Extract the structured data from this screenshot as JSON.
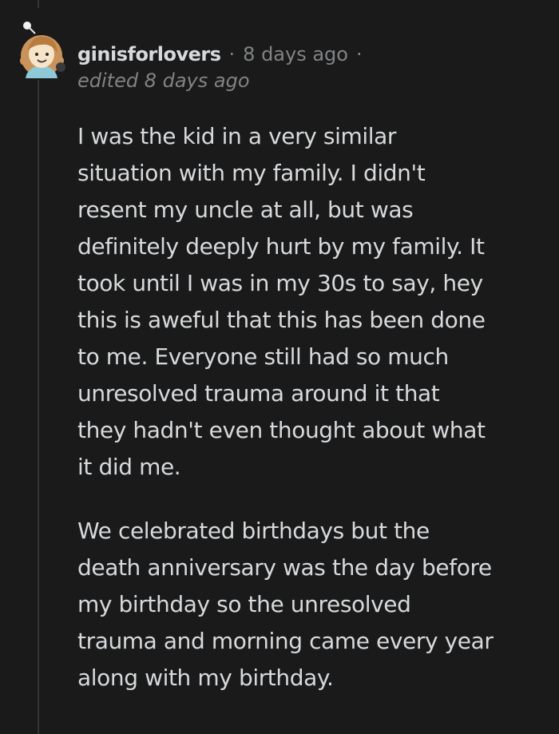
{
  "comment": {
    "username": "ginisforlovers",
    "separator": "·",
    "timestamp": "8 days ago",
    "trailing_separator": "·",
    "edited": "edited 8 days ago",
    "paragraphs": [
      {
        "lines": [
          "I was the kid in a very similar",
          "situation with my family. I didn't",
          "resent my uncle at all, but was",
          "definitely deeply hurt by my family. It",
          "took until I was in my 30s to say, hey",
          "this is aweful that this has been done",
          "to me. Everyone still had so much",
          "unresolved trauma around it that",
          "they hadn't even thought about what",
          "it did me."
        ]
      },
      {
        "lines": [
          "We celebrated birthdays but the",
          "death anniversary was the day before",
          "my birthday so the unresolved",
          "trauma and morning came every year",
          "along with my birthday."
        ]
      }
    ],
    "avatar_icon": "user-avatar-icon",
    "colors": {
      "background": "#1a1a1b",
      "text": "#d7dadc",
      "muted": "#818384",
      "thread_line": "#343536"
    }
  }
}
